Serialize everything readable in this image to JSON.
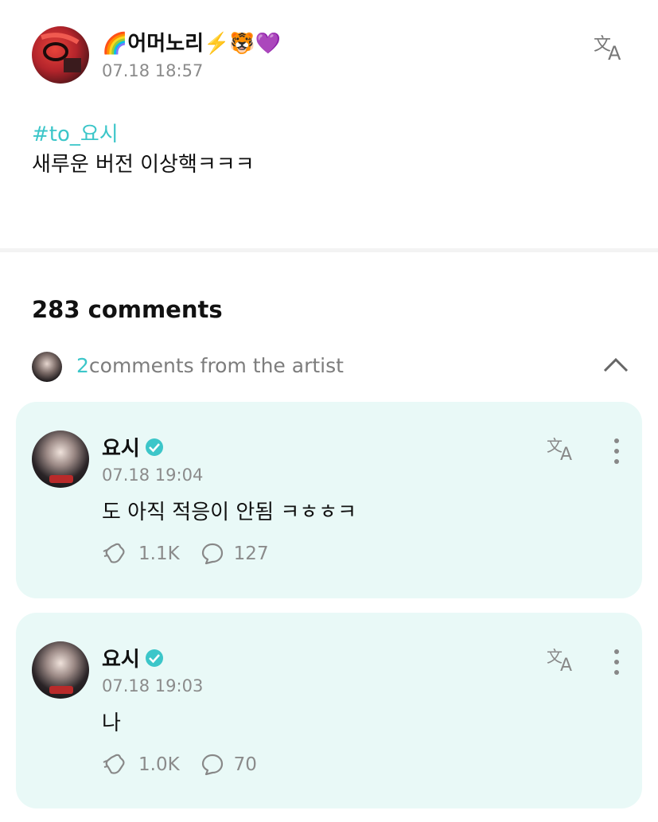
{
  "post": {
    "author": "🌈어머노리⚡️🐯💜",
    "time": "07.18 18:57",
    "hashtag": "#to_요시",
    "body": "새루운 버전 이상핵ㅋㅋㅋ"
  },
  "comments_section": {
    "count_label": "283 comments",
    "artist_count": "2",
    "artist_label": "comments from the artist"
  },
  "artist_comments": [
    {
      "name": "요시",
      "time": "07.18 19:04",
      "text": "도 아직 적응이 안됨 ㅋㅎㅎㅋ",
      "likes": "1.1K",
      "replies": "127"
    },
    {
      "name": "요시",
      "time": "07.18 19:03",
      "text": "나",
      "likes": "1.0K",
      "replies": "70"
    }
  ],
  "icons": {
    "translate": "translate-icon",
    "verified": "verified-badge-icon",
    "like": "cheer-icon",
    "reply": "comment-bubble-icon",
    "more": "more-vertical-icon",
    "collapse": "chevron-up-icon"
  },
  "colors": {
    "accent": "#3cc6c9",
    "card_bg": "#e9f9f7",
    "muted": "#8b8b8b"
  }
}
